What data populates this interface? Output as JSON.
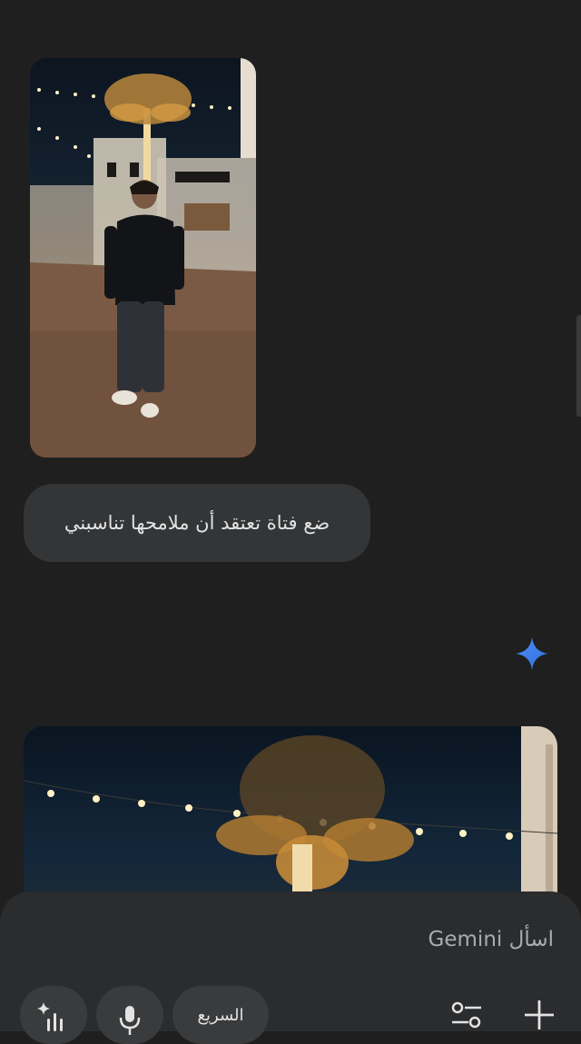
{
  "conversation": {
    "user_prompt": "ضع فتاة تعتقد أن ملامحها تناسبني"
  },
  "composer": {
    "placeholder": "اسأل Gemini",
    "mode_label": "السريع"
  },
  "icons": {
    "response": "gemini-sparkle-icon",
    "live": "live-sparkle-icon",
    "mic": "microphone-icon",
    "tools": "tools-sliders-icon",
    "add": "plus-icon"
  },
  "colors": {
    "background": "#1f1f1f",
    "bubble": "#333537",
    "composer": "#2b2c2e",
    "sparkle": "#4285f4"
  }
}
